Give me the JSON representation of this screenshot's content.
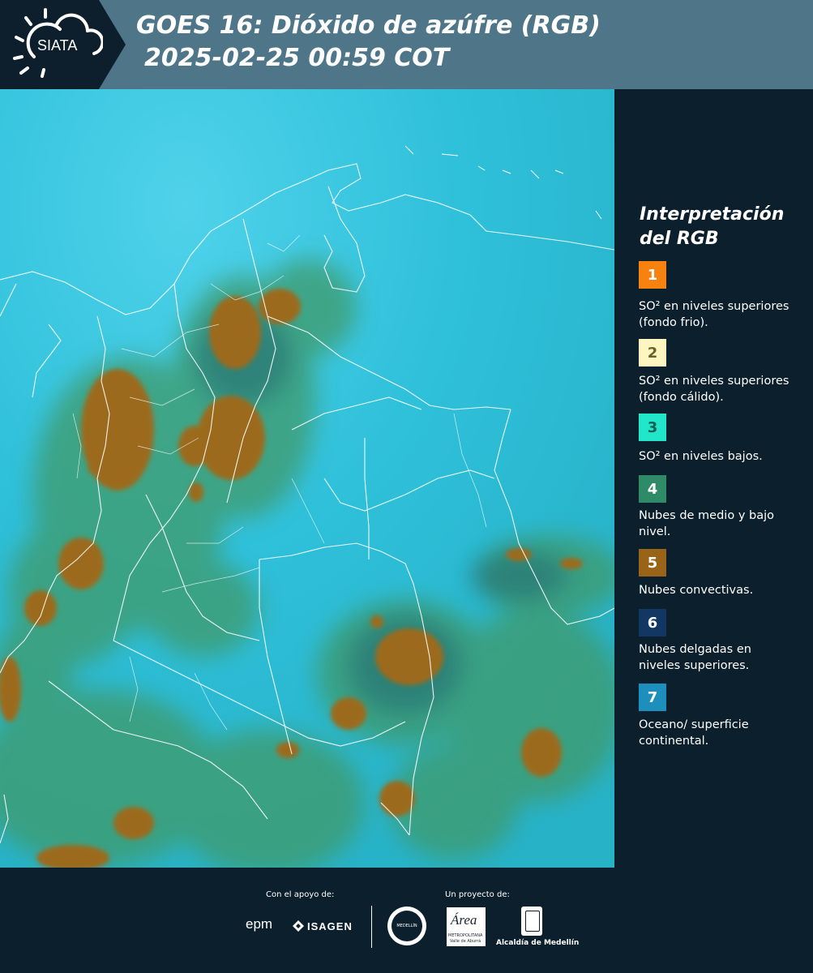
{
  "header": {
    "logo_text": "SIATA",
    "title_line1": "GOES 16: Dióxido de azúfre (RGB)",
    "title_line2": "2025-02-25 00:59 COT"
  },
  "legend": {
    "title_line1": "Interpretación",
    "title_line2": "del RGB",
    "items": [
      {
        "num": "1",
        "color": "#f7820f",
        "num_color": "#ffffff",
        "label": "SO² en niveles superiores (fondo frio)."
      },
      {
        "num": "2",
        "color": "#fdf6c0",
        "num_color": "#6a6030",
        "label": "SO² en niveles superiores (fondo cálido)."
      },
      {
        "num": "3",
        "color": "#22e6c9",
        "num_color": "#145e55",
        "label": "SO² en niveles bajos."
      },
      {
        "num": "4",
        "color": "#2f8a68",
        "num_color": "#ffffff",
        "label": "Nubes de medio y bajo nivel."
      },
      {
        "num": "5",
        "color": "#9a6418",
        "num_color": "#ffffff",
        "label": "Nubes convectivas."
      },
      {
        "num": "6",
        "color": "#133763",
        "num_color": "#ffffff",
        "label": "Nubes delgadas en niveles superiores."
      },
      {
        "num": "7",
        "color": "#1d8fbd",
        "num_color": "#ffffff",
        "label": "Oceano/ superficie continental."
      }
    ]
  },
  "footer": {
    "support_text": "Con el apoyo de:",
    "project_text": "Un proyecto de:",
    "epm_text": "epm",
    "isagen_text": "ISAGEN",
    "area_text": "Área",
    "area_sub1": "METROPOLITANA",
    "area_sub2": "Valle de Aburrá",
    "medellin_text": "Alcaldía de Medellín",
    "seal_text": "MEDELLÍN"
  }
}
